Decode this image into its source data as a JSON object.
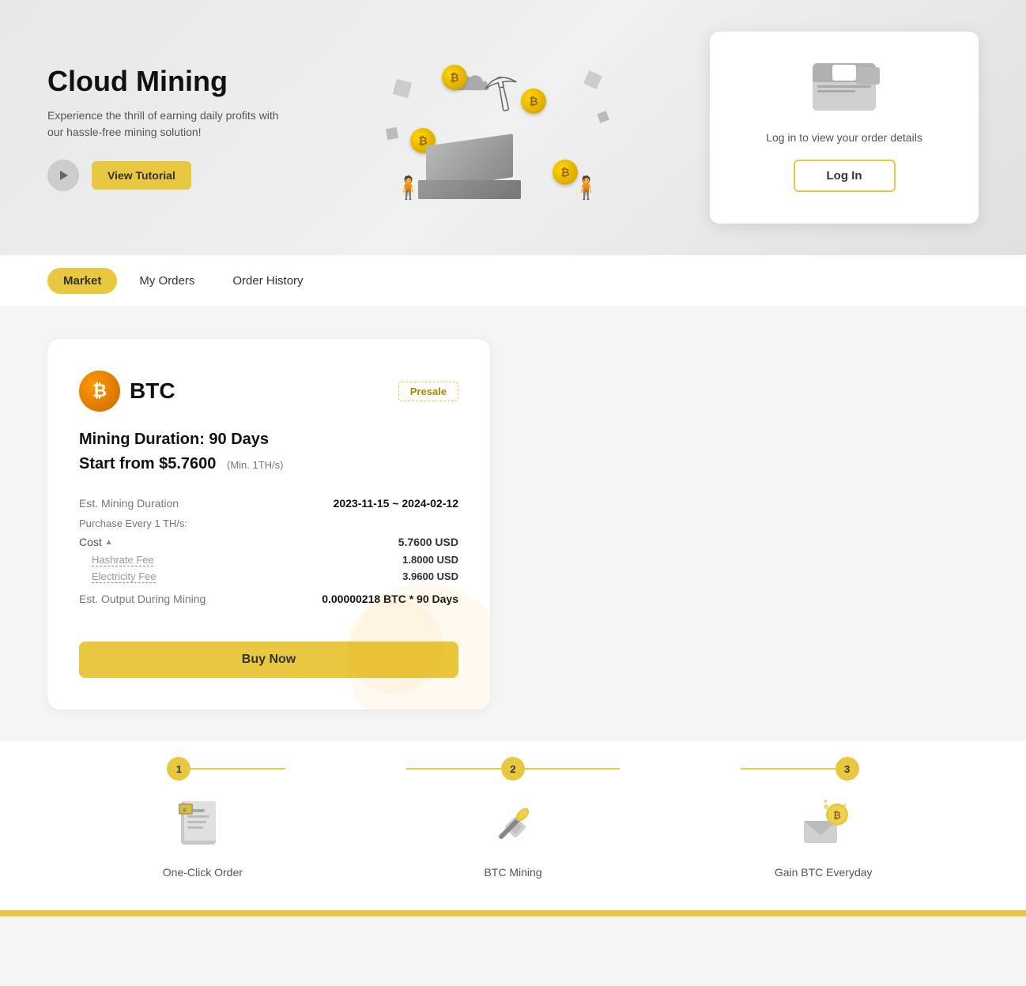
{
  "hero": {
    "title": "Cloud Mining",
    "subtitle": "Experience the thrill of earning daily profits with our hassle-free mining solution!",
    "tutorial_btn": "View Tutorial",
    "login_card": {
      "text": "Log in to view your order details",
      "login_btn": "Log In"
    }
  },
  "nav": {
    "tabs": [
      {
        "id": "market",
        "label": "Market",
        "active": true
      },
      {
        "id": "my-orders",
        "label": "My Orders",
        "active": false
      },
      {
        "id": "order-history",
        "label": "Order History",
        "active": false
      }
    ]
  },
  "mining_card": {
    "coin": "BTC",
    "badge": "Presale",
    "duration_label": "Mining Duration: 90 Days",
    "start_price_label": "Start from $5.7600",
    "min_label": "(Min. 1TH/s)",
    "est_duration_label": "Est. Mining Duration",
    "est_duration_value": "2023-11-15 ~ 2024-02-12",
    "purchase_label": "Purchase Every 1 TH/s:",
    "cost_label": "Cost",
    "cost_value": "5.7600 USD",
    "hashrate_fee_label": "Hashrate Fee",
    "hashrate_fee_value": "1.8000 USD",
    "electricity_fee_label": "Electricity Fee",
    "electricity_fee_value": "3.9600 USD",
    "output_label": "Est. Output During Mining",
    "output_value": "0.00000218 BTC * 90 Days",
    "buy_btn": "Buy Now"
  },
  "steps": [
    {
      "num": "1",
      "icon": "document-icon",
      "label": "One-Click Order"
    },
    {
      "num": "2",
      "icon": "pickaxe-icon",
      "label": "BTC Mining"
    },
    {
      "num": "3",
      "icon": "coin-gain-icon",
      "label": "Gain BTC Everyday"
    }
  ]
}
